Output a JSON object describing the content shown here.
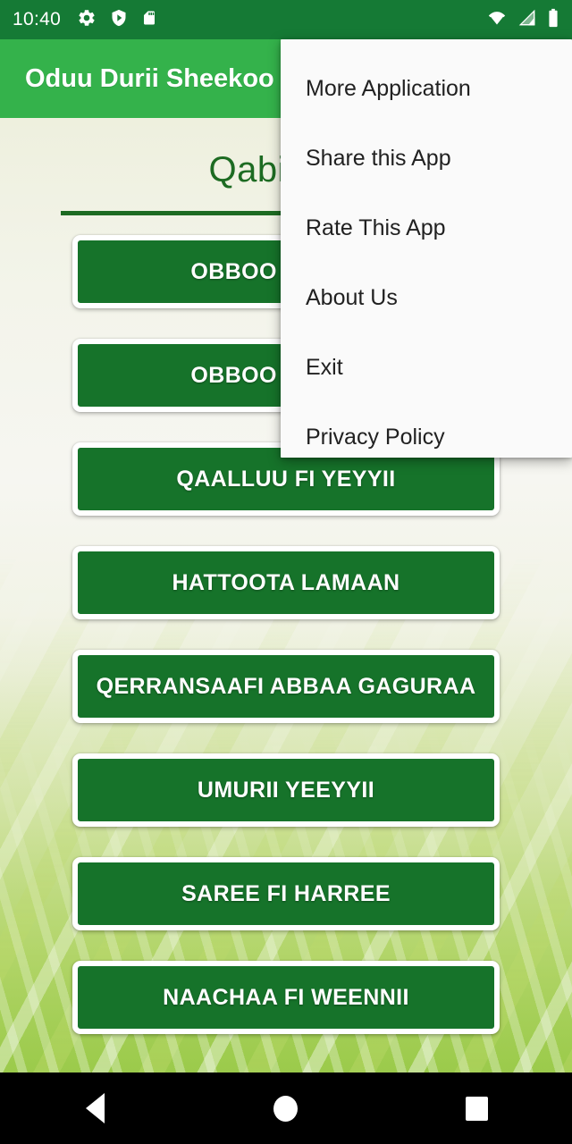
{
  "statusbar": {
    "time": "10:40",
    "left_icons": [
      "gear-icon",
      "play-protect-icon",
      "sd-card-icon"
    ],
    "right_icons": [
      "wifi-icon",
      "signal-icon",
      "battery-icon"
    ],
    "background_color": "#157a35"
  },
  "appbar": {
    "title": "Oduu Durii Sheekoo",
    "background_color": "#34b24b",
    "text_color": "#ffffff"
  },
  "main": {
    "heading": "Qabiyyee",
    "heading_color": "#1d6b22",
    "button_color": "#16732a",
    "button_text_color": "#ffffff",
    "items": [
      {
        "label": "OBBOO BULGUU"
      },
      {
        "label": "OBBOO BULGUU"
      },
      {
        "label": "QAALLUU FI YEYYII"
      },
      {
        "label": "HATTOOTA LAMAAN"
      },
      {
        "label": "QERRANSAAFI ABBAA GAGURAA"
      },
      {
        "label": "UMURII YEEYYII"
      },
      {
        "label": "SAREE FI HARREE"
      },
      {
        "label": "NAACHAA FI WEENNII"
      }
    ]
  },
  "overflow_menu": {
    "visible": true,
    "background_color": "#fafafa",
    "items": [
      {
        "label": "More Application"
      },
      {
        "label": "Share this App"
      },
      {
        "label": "Rate This App"
      },
      {
        "label": "About Us"
      },
      {
        "label": "Exit"
      },
      {
        "label": "Privacy Policy"
      }
    ]
  },
  "navbar": {
    "background_color": "#000000",
    "buttons": [
      {
        "name": "back-button",
        "icon": "triangle-left-icon"
      },
      {
        "name": "home-button",
        "icon": "circle-icon"
      },
      {
        "name": "recents-button",
        "icon": "square-icon"
      }
    ]
  }
}
